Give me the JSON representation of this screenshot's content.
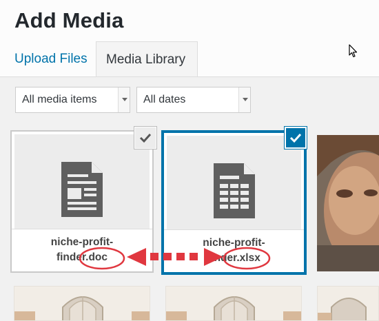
{
  "header": {
    "title": "Add Media"
  },
  "tabs": [
    {
      "label": "Upload Files",
      "active": false
    },
    {
      "label": "Media Library",
      "active": true
    }
  ],
  "filters": {
    "type_select": {
      "value": "All media items"
    },
    "date_select": {
      "value": "All dates"
    }
  },
  "attachments": [
    {
      "filename_line1": "niche-profit-",
      "filename_line2": "finder.doc",
      "icon": "document-icon",
      "selected": false
    },
    {
      "filename_line1": "niche-profit-",
      "filename_line2": "finder.xlsx",
      "icon": "spreadsheet-icon",
      "selected": true
    }
  ],
  "colors": {
    "accent": "#0073aa",
    "annotation_red": "#e0373f",
    "title_text": "#23282d"
  },
  "icons": [
    "document-icon",
    "spreadsheet-icon",
    "checkmark-icon",
    "mouse-pointer-icon",
    "dropdown-arrow-icon"
  ]
}
